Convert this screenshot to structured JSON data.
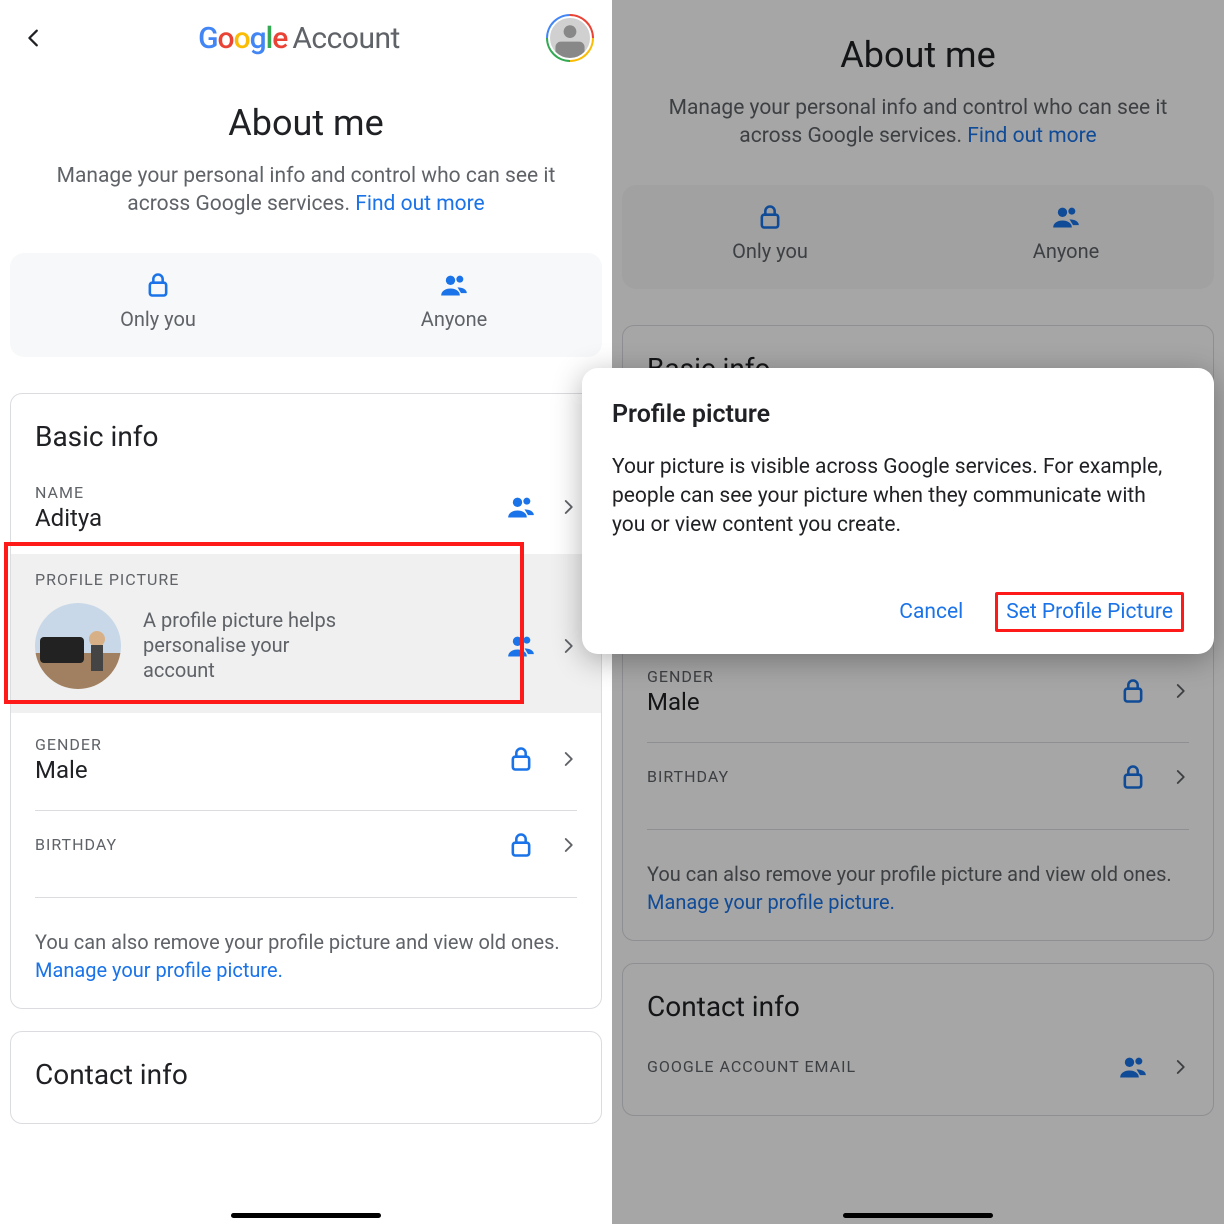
{
  "header": {
    "logo_account": "Account"
  },
  "page": {
    "title": "About me",
    "blurb_a": "Manage your personal info and control who can see it across Google services. ",
    "learn_more": "Find out more"
  },
  "visibility": {
    "only_you": "Only you",
    "anyone": "Anyone"
  },
  "basic": {
    "title": "Basic info",
    "name_label": "NAME",
    "name_value": "Aditya",
    "pp_label": "PROFILE PICTURE",
    "pp_desc": "A profile picture helps personalise your account",
    "gender_label": "GENDER",
    "gender_value": "Male",
    "birthday_label": "BIRTHDAY",
    "remove_note_a": "You can also remove your profile picture and view old ones. ",
    "remove_link": "Manage your profile picture."
  },
  "contact": {
    "title": "Contact info",
    "email_label": "GOOGLE ACCOUNT EMAIL"
  },
  "dialog": {
    "title": "Profile picture",
    "body": "Your picture is visible across Google services. For example, people can see your picture when they communicate with you or view content you create.",
    "cancel": "Cancel",
    "confirm": "Set Profile Picture"
  }
}
